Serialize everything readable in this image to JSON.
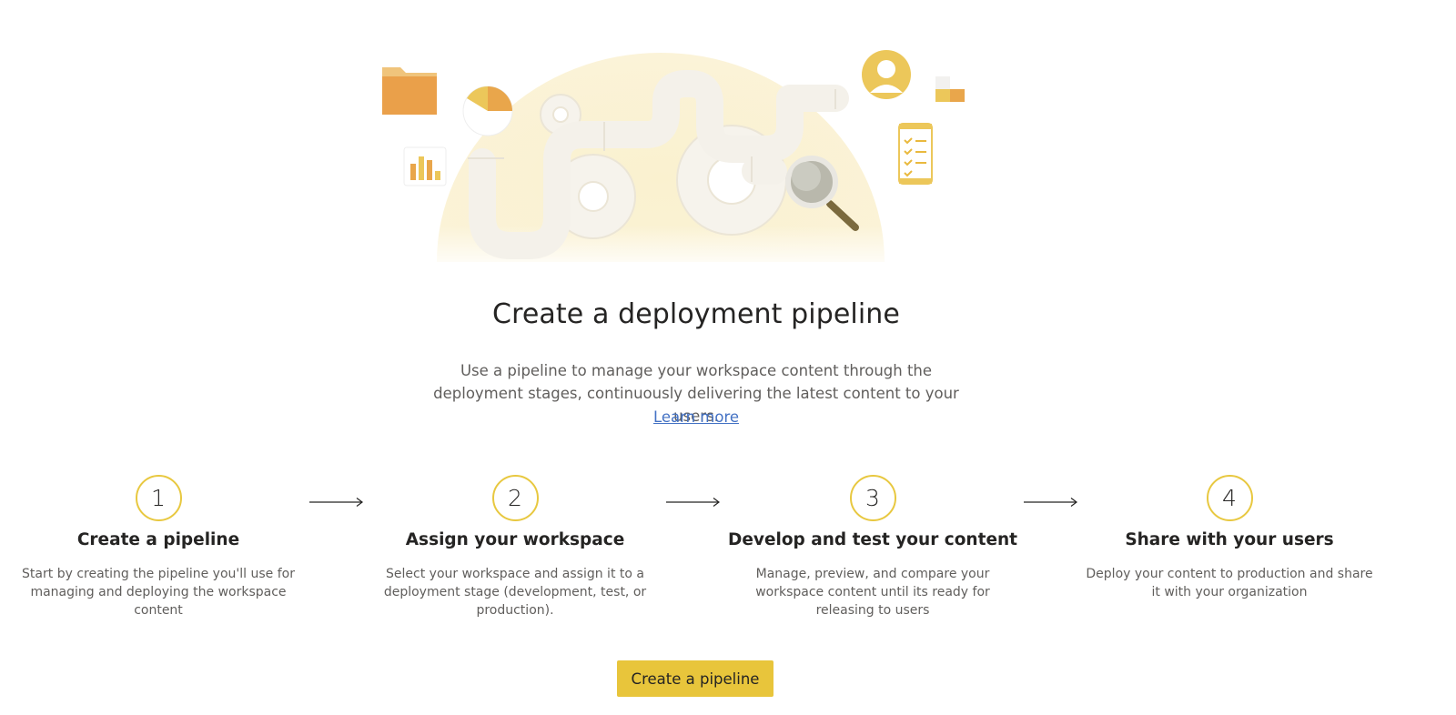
{
  "header": {
    "title": "Create a deployment pipeline",
    "description": "Use a pipeline to manage your workspace content through the deployment stages, continuously delivering the latest content to your users.",
    "learn_more_label": "Learn more"
  },
  "steps": [
    {
      "number": "1",
      "title": "Create a pipeline",
      "description": "Start by creating the pipeline you'll use for managing and deploying the workspace content"
    },
    {
      "number": "2",
      "title": "Assign your workspace",
      "description": "Select your workspace and assign it to a deployment stage (development, test, or production)."
    },
    {
      "number": "3",
      "title": "Develop and test your content",
      "description": "Manage, preview, and compare your workspace content until its ready for releasing to users"
    },
    {
      "number": "4",
      "title": "Share with your users",
      "description": "Deploy your content to production and share it with your organization"
    }
  ],
  "cta": {
    "label": "Create a pipeline"
  },
  "colors": {
    "accent": "#e8c53b",
    "link": "#4472c4",
    "text_primary": "#252423",
    "text_secondary": "#605e5c"
  },
  "icons": {
    "hero": "pipeline-illustration",
    "arrow": "arrow-right-icon"
  }
}
